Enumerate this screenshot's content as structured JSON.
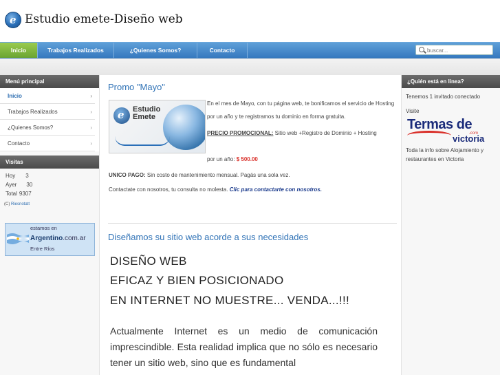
{
  "header": {
    "logo_letter": "e",
    "title": "Estudio emete-Diseño web"
  },
  "nav": {
    "items": [
      "Inicio",
      "Trabajos Realizados",
      "¿Quienes Somos?",
      "Contacto"
    ],
    "search_placeholder": "buscar..."
  },
  "left": {
    "menu_title": "Menú principal",
    "menu_items": [
      "Inicio",
      "Trabajos Realizados",
      "¿Quienes Somos?",
      "Contacto"
    ],
    "chevron": "›",
    "visits_title": "Visitas",
    "visits": [
      {
        "label": "Hoy",
        "value": "3"
      },
      {
        "label": "Ayer",
        "value": "30"
      },
      {
        "label": "Total",
        "value": "9307"
      }
    ],
    "credit_prefix": "(C) ",
    "credit_link": "Riesnotatt",
    "banner_line1": "estamos en",
    "banner_brand": "Argentino",
    "banner_suffix": ".com.ar",
    "banner_line3": "Entre Ríos"
  },
  "main": {
    "promo_title": "Promo \"Mayo\"",
    "promo_logo_line1": "Estudio",
    "promo_logo_line2": "Emete",
    "promo_text1": "En el mes de Mayo, con tu página web, te bonificamos el servicio de Hosting por un año y te registramos tu dominio en forma gratuita.",
    "promo_precio_label": "PRECIO PROMOCIONAL:",
    "promo_precio_text": " Sitio web +Registro de Dominio + Hosting",
    "promo_year_label": "por un año: ",
    "promo_price": "$ 500.00",
    "unico_label": "UNICO PAGO:",
    "unico_text": " Sin costo de mantenimiento mensual. Pagás una sola vez.",
    "contact_text": "Contactate con nosotros, tu consulta no molesta. ",
    "contact_link": "Clic para contactarte con nosotros.",
    "design_title": "Diseñamos su sitio web acorde a sus necesidades",
    "big_line1": "DISEÑO WEB",
    "big_line2": "EFICAZ Y BIEN POSICIONADO",
    "big_line3": "EN INTERNET NO MUESTRE... VENDA...!!!",
    "body_para": "Actualmente Internet es un medio de comunicación imprescindible. Esta realidad implica que no sólo es necesario tener un sitio web, sino que es fundamental"
  },
  "right": {
    "online_title": "¿Quién está en línea?",
    "online_text": "Tenemos 1 invitado conectado",
    "visite": "Visite",
    "termas_word": "Termas de",
    "termas_com": ".com",
    "termas_city": "victoria",
    "info_text": "Toda la info sobre Alojamiento y restaurantes en Victoria"
  },
  "colors": {
    "nav_blue": "#3679bf",
    "nav_active": "#6aa532",
    "title_blue": "#2f72b6",
    "price_red": "#d9302a"
  }
}
